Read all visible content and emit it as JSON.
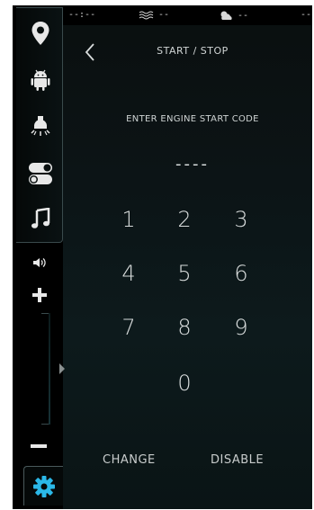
{
  "status_bar": {
    "time": "--:--",
    "temperature": "--",
    "weather": "--",
    "extra": "--"
  },
  "header": {
    "title": "START / STOP",
    "back_icon": "chevron-left-icon"
  },
  "prompt": "ENTER ENGINE START CODE",
  "code_display": "----",
  "keypad": {
    "k1": "1",
    "k2": "2",
    "k3": "3",
    "k4": "4",
    "k5": "5",
    "k6": "6",
    "k7": "7",
    "k8": "8",
    "k9": "9",
    "k0": "0"
  },
  "actions": {
    "change": "CHANGE",
    "disable": "DISABLE"
  },
  "sidebar": {
    "items": [
      "location-pin-icon",
      "android-icon",
      "light-bulb-icon",
      "toggle-icon",
      "music-note-icon"
    ],
    "settings_icon": "gear-icon",
    "settings_color": "#2bb8e8"
  }
}
